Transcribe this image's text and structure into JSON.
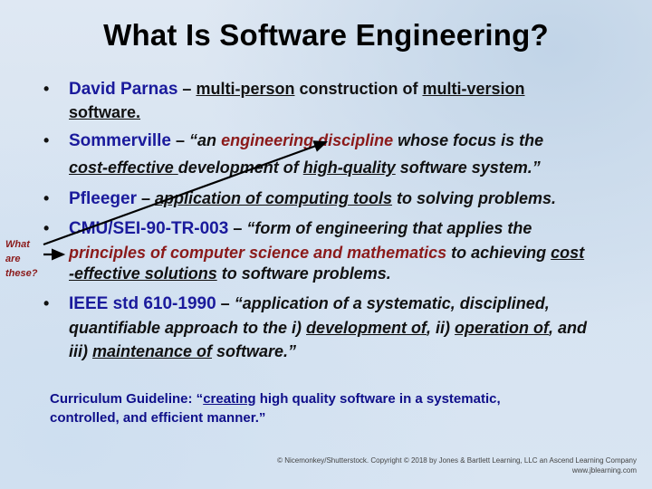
{
  "slide": {
    "title": "What Is Software Engineering?",
    "definitions": [
      {
        "name": "David Parnas",
        "dash": "–",
        "line1": [
          {
            "text": "multi-person",
            "style": "b u"
          },
          {
            "text": " construction of ",
            "style": "b"
          },
          {
            "text": "multi-version",
            "style": "b u"
          }
        ],
        "line2": [
          {
            "text": "software.",
            "style": "b u"
          }
        ]
      },
      {
        "name": "Sommerville",
        "dash": "–",
        "line1": [
          {
            "text": "“an ",
            "style": "bi"
          },
          {
            "text": "engineering discipline",
            "style": "red"
          },
          {
            "text": " whose focus is the",
            "style": "bi"
          }
        ],
        "line2": [
          {
            "text": "cost-effective ",
            "style": "bi u"
          },
          {
            "text": "development of ",
            "style": "bi"
          },
          {
            "text": "high-quality",
            "style": "bi u"
          },
          {
            "text": " software system.”",
            "style": "bi"
          }
        ]
      },
      {
        "name": "Pfleeger",
        "dash": "–",
        "line1": [
          {
            "text": "application of computing tools",
            "style": "bi u"
          },
          {
            "text": " to solving problems.",
            "style": "bi"
          }
        ]
      },
      {
        "name": "CMU/SEI-90-TR-003",
        "dash": "–",
        "line1": [
          {
            "text": "“form of engineering that applies the",
            "style": "bi"
          }
        ],
        "line2": [
          {
            "text": "principles of computer science and mathematics",
            "style": "red"
          },
          {
            "text": " to achieving ",
            "style": "bi"
          },
          {
            "text": "cost",
            "style": "bi u"
          }
        ],
        "line3": [
          {
            "text": "-effective solutions",
            "style": "bi u"
          },
          {
            "text": " to software problems.",
            "style": "bi"
          }
        ]
      },
      {
        "name": "IEEE std 610-1990",
        "dash": "–",
        "line1": [
          {
            "text": "“application of a systematic, disciplined,",
            "style": "bi"
          }
        ],
        "line2": [
          {
            "text": "quantifiable approach to the i) ",
            "style": "bi"
          },
          {
            "text": "development of",
            "style": "bi u"
          },
          {
            "text": ", ii) ",
            "style": "bi"
          },
          {
            "text": "operation of",
            "style": "bi u"
          },
          {
            "text": ", and",
            "style": "bi"
          }
        ],
        "line3": [
          {
            "text": "iii) ",
            "style": "bi"
          },
          {
            "text": "maintenance of",
            "style": "bi u"
          },
          {
            "text": " software.”",
            "style": "bi"
          }
        ]
      }
    ],
    "side_note": [
      "What",
      "are",
      "these?"
    ],
    "guideline": {
      "prefix": "Curriculum Guideline: “",
      "underlined": "creating",
      "rest": " high quality software in a systematic,",
      "line2": "controlled, and efficient manner.”"
    },
    "copyright": {
      "line1": "© Nicemonkey/Shutterstock. Copyright © 2018 by Jones & Bartlett Learning, LLC an Ascend Learning Company",
      "line2": "www.jblearning.com"
    },
    "colors": {
      "name": "#1a1a9c",
      "emphasis_red": "#8b1a1a",
      "guideline": "#0f0f8a"
    }
  }
}
